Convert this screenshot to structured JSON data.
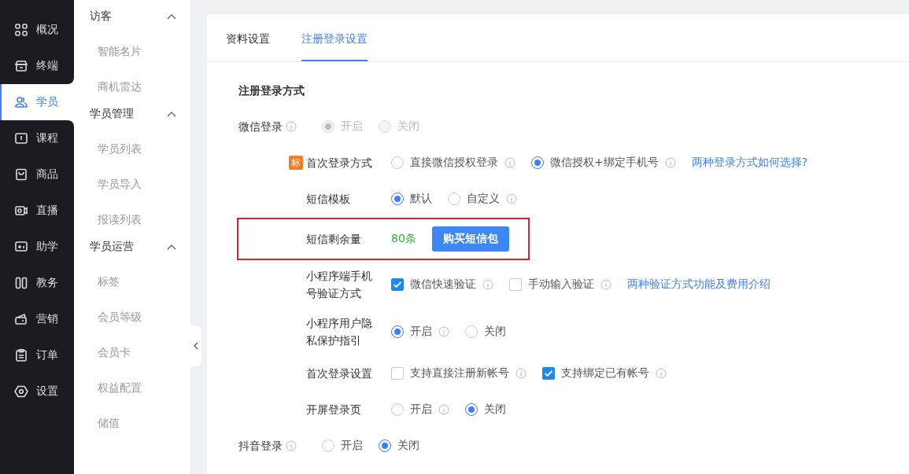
{
  "nav": [
    {
      "label": "概况",
      "selected": false
    },
    {
      "label": "终端",
      "selected": false
    },
    {
      "label": "学员",
      "selected": true
    },
    {
      "label": "课程",
      "selected": false
    },
    {
      "label": "商品",
      "selected": false
    },
    {
      "label": "直播",
      "selected": false
    },
    {
      "label": "助学",
      "selected": false
    },
    {
      "label": "教务",
      "selected": false
    },
    {
      "label": "营销",
      "selected": false
    },
    {
      "label": "订单",
      "selected": false
    },
    {
      "label": "设置",
      "selected": false
    }
  ],
  "subnav": [
    {
      "title": "访客",
      "expanded": true,
      "items": [
        "智能名片",
        "商机雷达"
      ]
    },
    {
      "title": "学员管理",
      "expanded": true,
      "items": [
        "学员列表",
        "学员导入",
        "报读列表"
      ]
    },
    {
      "title": "学员运营",
      "expanded": true,
      "items": [
        "标签",
        "会员等级",
        "会员卡",
        "权益配置",
        "储值"
      ]
    }
  ],
  "tabs": [
    {
      "label": "资料设置",
      "selected": false
    },
    {
      "label": "注册登录设置",
      "selected": true
    }
  ],
  "section_title": "注册登录方式",
  "settings": [
    {
      "kind": "radio",
      "label": "微信登录",
      "info": true,
      "disabled": true,
      "options": [
        {
          "label": "开启",
          "selected": true,
          "info": false
        },
        {
          "label": "关闭",
          "selected": false,
          "info": false
        }
      ],
      "children": [
        {
          "kind": "radio",
          "badge": "标",
          "label": "首次登录方式",
          "options": [
            {
              "label": "直接微信授权登录",
              "selected": false,
              "info": true
            },
            {
              "label": "微信授权+绑定手机号",
              "selected": true,
              "info": true
            }
          ],
          "link": "两种登录方式如何选择?"
        },
        {
          "kind": "radio",
          "label": "短信模板",
          "options": [
            {
              "label": "默认",
              "selected": true,
              "info": false
            },
            {
              "label": "自定义",
              "selected": false,
              "info": true
            }
          ]
        },
        {
          "kind": "quota",
          "label": "短信剩余量",
          "count": "80条",
          "button": "购买短信包",
          "highlighted": true
        },
        {
          "kind": "checkbox",
          "label": "小程序端手机号验证方式",
          "options": [
            {
              "label": "微信快速验证",
              "checked": true,
              "info": true
            },
            {
              "label": "手动输入验证",
              "checked": false,
              "info": true
            }
          ],
          "link": "两种验证方式功能及费用介绍"
        },
        {
          "kind": "radio",
          "label": "小程序用户隐私保护指引",
          "options": [
            {
              "label": "开启",
              "selected": true,
              "info": true
            },
            {
              "label": "关闭",
              "selected": false,
              "info": false
            }
          ]
        },
        {
          "kind": "checkbox",
          "label": "首次登录设置",
          "options": [
            {
              "label": "支持直接注册新帐号",
              "checked": false,
              "info": true
            },
            {
              "label": "支持绑定已有帐号",
              "checked": true,
              "info": true
            }
          ]
        },
        {
          "kind": "radio",
          "label": "开屏登录页",
          "options": [
            {
              "label": "开启",
              "selected": false,
              "info": true
            },
            {
              "label": "关闭",
              "selected": true,
              "info": false
            }
          ]
        }
      ]
    },
    {
      "kind": "radio",
      "label": "抖音登录",
      "info": true,
      "options": [
        {
          "label": "开启",
          "selected": false,
          "info": false
        },
        {
          "label": "关闭",
          "selected": true,
          "info": false
        }
      ]
    }
  ]
}
